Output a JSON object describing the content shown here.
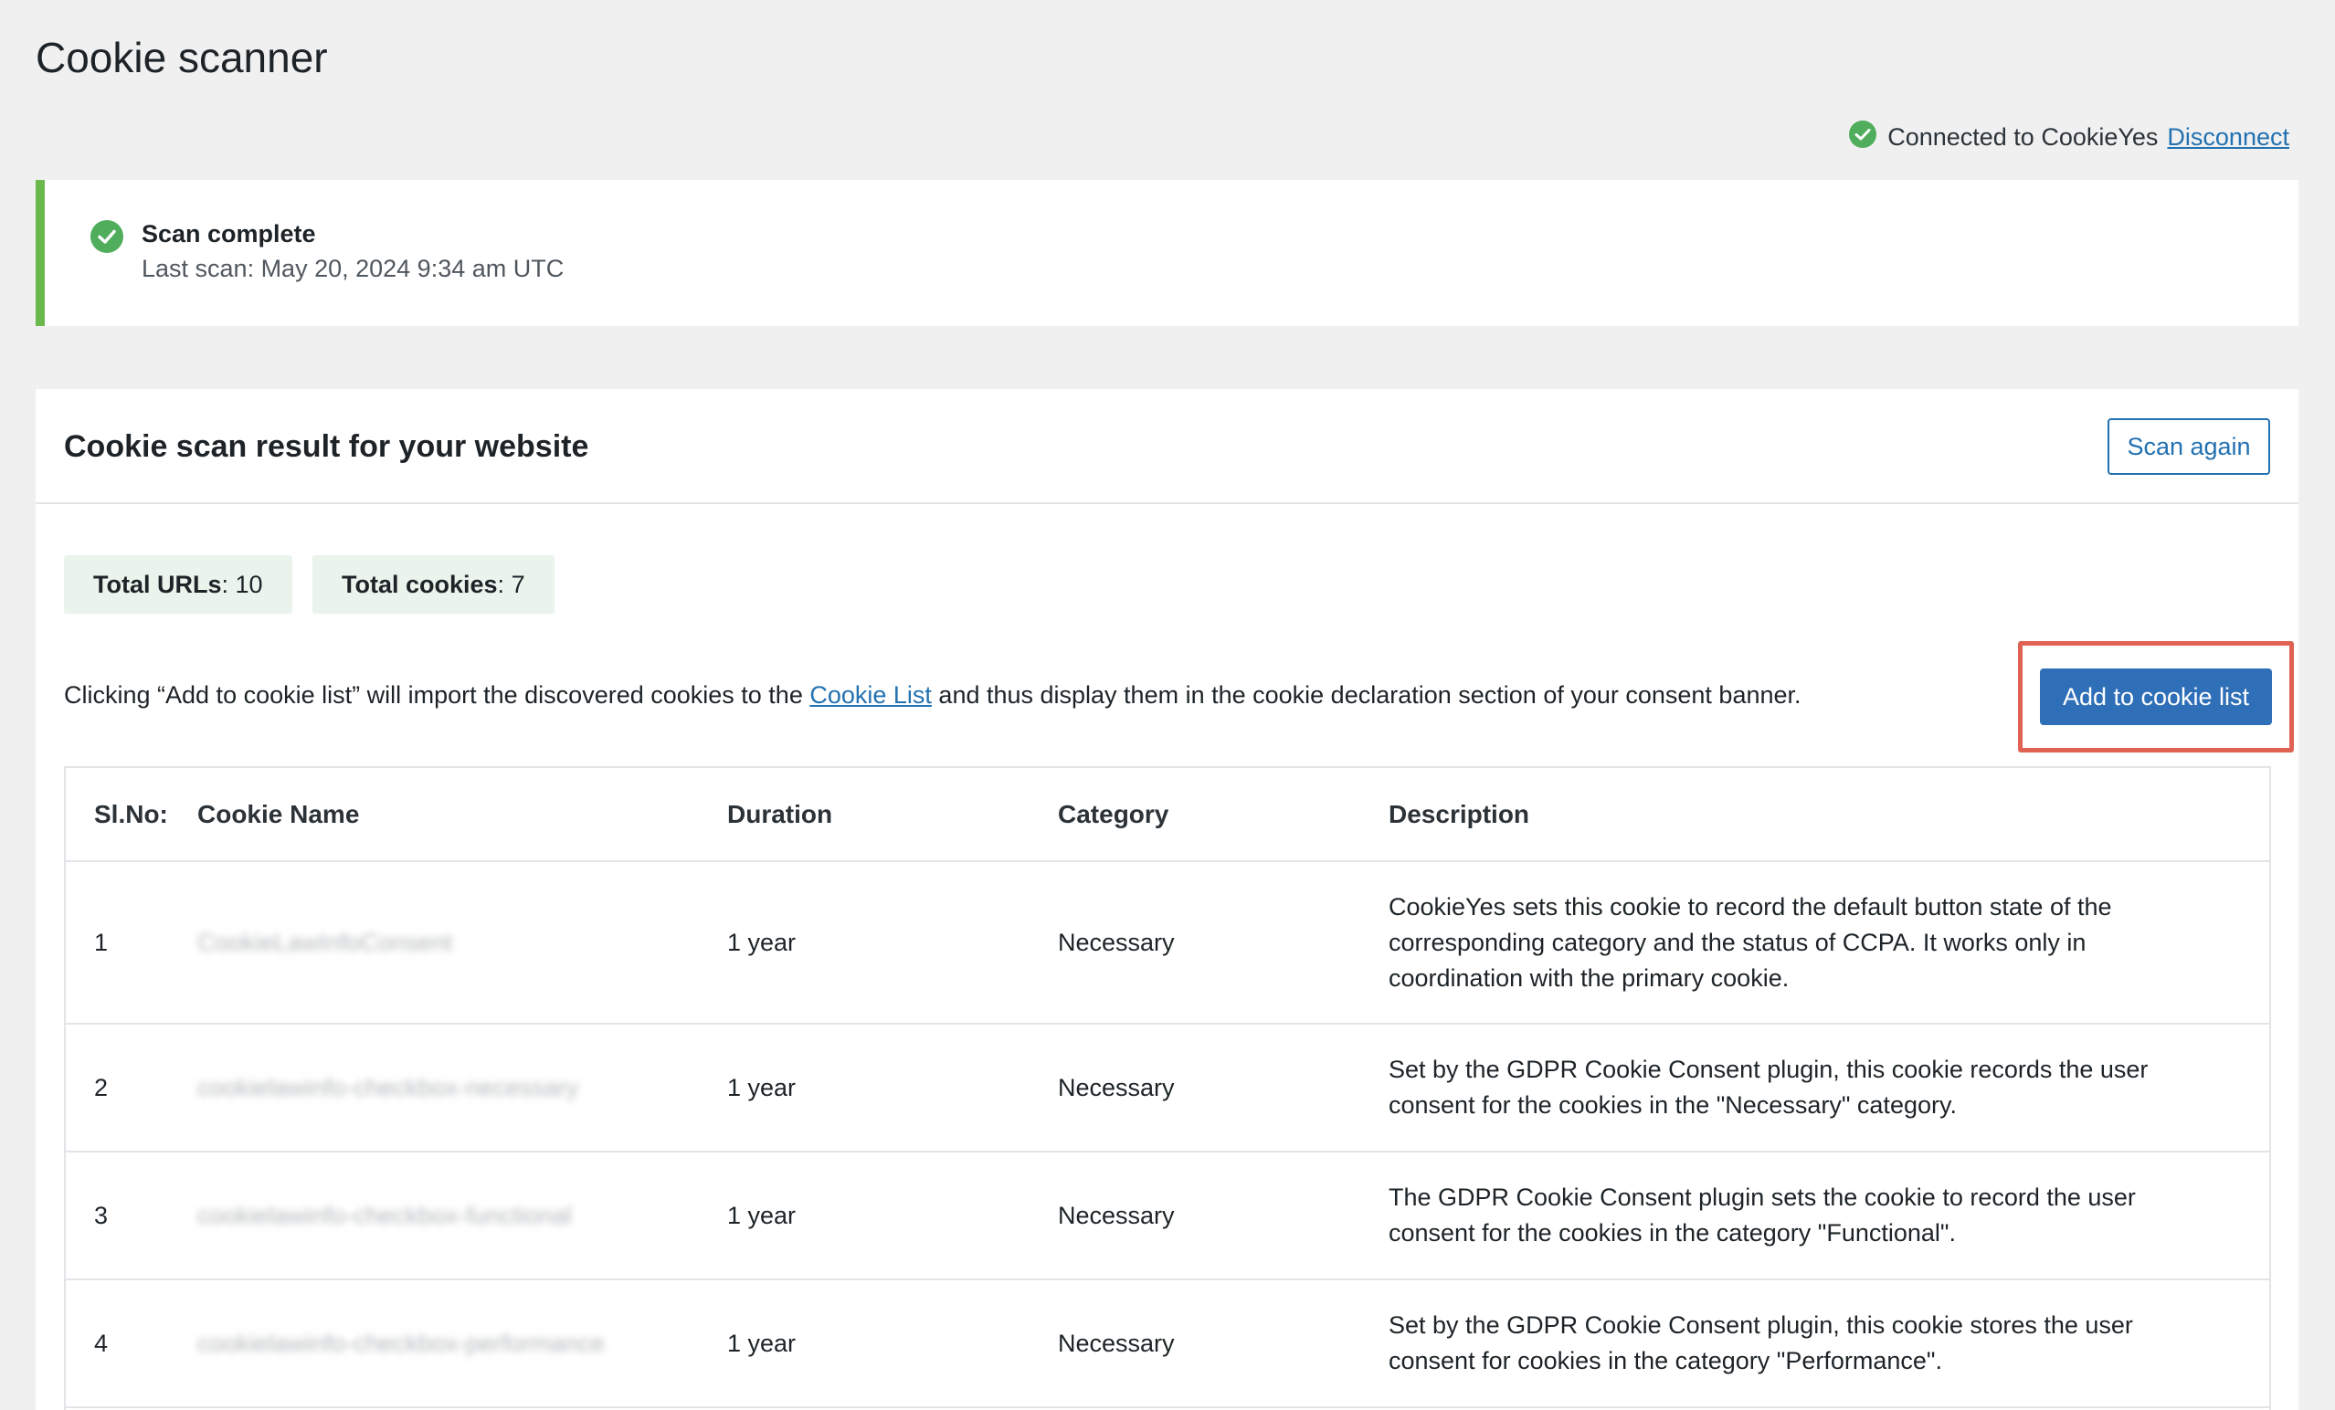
{
  "page": {
    "title": "Cookie scanner"
  },
  "connection": {
    "status_text": "Connected to CookieYes",
    "disconnect_label": "Disconnect"
  },
  "notice": {
    "title": "Scan complete",
    "last_scan": "Last scan: May 20, 2024 9:34 am UTC"
  },
  "card": {
    "title": "Cookie scan result for your website",
    "scan_again_label": "Scan again"
  },
  "stats": {
    "urls_label": "Total URLs",
    "urls_value": "10",
    "cookies_label": "Total cookies",
    "cookies_value": "7"
  },
  "info": {
    "text_before": "Clicking “Add to cookie list” will import the discovered cookies to the ",
    "link": "Cookie List",
    "text_after": " and thus display them in the cookie declaration section of your consent banner.",
    "add_button_label": "Add to cookie list"
  },
  "table": {
    "headers": [
      "Sl.No:",
      "Cookie Name",
      "Duration",
      "Category",
      "Description"
    ],
    "rows": [
      {
        "no": "1",
        "name": "CookieLawInfoConsent",
        "duration": "1 year",
        "category": "Necessary",
        "description": "CookieYes sets this cookie to record the default button state of the corresponding category and the status of CCPA. It works only in coordination with the primary cookie."
      },
      {
        "no": "2",
        "name": "cookielawinfo-checkbox-necessary",
        "duration": "1 year",
        "category": "Necessary",
        "description": "Set by the GDPR Cookie Consent plugin, this cookie records the user consent for the cookies in the \"Necessary\" category."
      },
      {
        "no": "3",
        "name": "cookielawinfo-checkbox-functional",
        "duration": "1 year",
        "category": "Necessary",
        "description": "The GDPR Cookie Consent plugin sets the cookie to record the user consent for the cookies in the category \"Functional\"."
      },
      {
        "no": "4",
        "name": "cookielawinfo-checkbox-performance",
        "duration": "1 year",
        "category": "Necessary",
        "description": "Set by the GDPR Cookie Consent plugin, this cookie stores the user consent for cookies in the category \"Performance\"."
      }
    ]
  },
  "colors": {
    "success": "#6bb84c",
    "primary": "#2e6fb7",
    "link": "#2271b1",
    "highlight": "#e06253"
  },
  "icons": {
    "check": "check-circle-icon"
  }
}
